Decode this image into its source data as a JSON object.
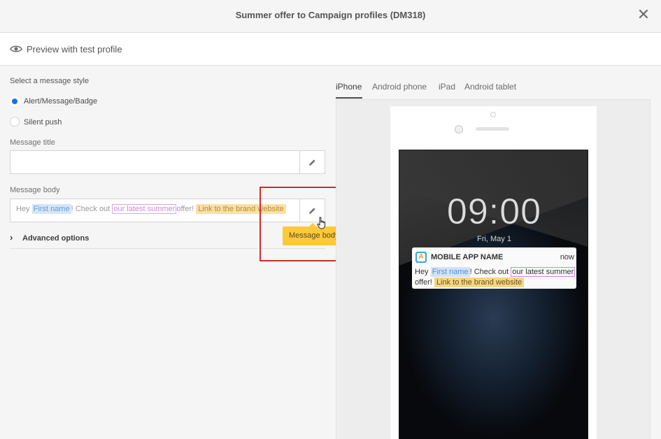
{
  "header": {
    "title": "Summer offer to Campaign profiles (DM318)",
    "close_icon": "close-icon"
  },
  "preview": {
    "label": "Preview with test profile",
    "icon": "eye-icon"
  },
  "form": {
    "style_label": "Select a message style",
    "options": [
      {
        "label": "Alert/Message/Badge",
        "selected": true
      },
      {
        "label": "Silent push",
        "selected": false
      }
    ],
    "title_label": "Message title",
    "title_value": "",
    "body_label": "Message body",
    "body": {
      "t1": "Hey",
      "token_first_name": "First name",
      "t2": "! Check out",
      "token_offer": "our latest summer",
      "t3": "offer!",
      "token_link": "Link to the brand website"
    },
    "advanced_label": "Advanced options"
  },
  "tooltip": {
    "text": "Message body"
  },
  "device_tabs": [
    "iPhone",
    "Android phone",
    "iPad",
    "Android tablet"
  ],
  "active_tab": "iPhone",
  "lockscreen": {
    "time": "09:00",
    "date": "Fri, May 1",
    "notification": {
      "app_icon_letter": "A",
      "app_name": "MOBILE APP NAME",
      "time": "now",
      "t1": "Hey",
      "token_first_name": "First name",
      "t2": "! Check out",
      "token_offer": "our latest summer",
      "t3": "offer!",
      "token_link": "Link to the brand website"
    }
  },
  "colors": {
    "accent": "#1473e6",
    "tooltip": "#fcc93a",
    "highlight_box": "#d22b2b"
  }
}
